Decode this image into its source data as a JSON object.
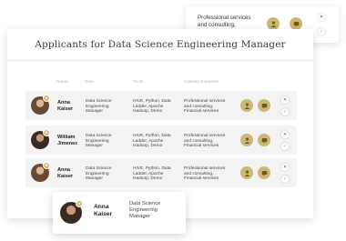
{
  "title": "Applicants for Data Science Engineering Manager",
  "columns": [
    "Name",
    "Role",
    "Tools",
    "Industry Expertise"
  ],
  "applicants": [
    {
      "first": "Anna",
      "last": "Kaiser",
      "role": [
        "Data Science",
        "Engineering",
        "Manager"
      ],
      "tools": [
        "HIVE, Python, Data",
        "Ladder, Apache",
        "Hadoop, Demo"
      ],
      "expertise": [
        "Professional services",
        "and consulting,",
        "Financial services"
      ]
    },
    {
      "first": "William",
      "last": "Jimenez",
      "role": [
        "Data Science",
        "Engineering",
        "Manager"
      ],
      "tools": [
        "HIVE, Python, Data",
        "Ladder, Apache",
        "Hadoop, Demo"
      ],
      "expertise": [
        "Professional services",
        "and consulting,",
        "Financial services"
      ]
    },
    {
      "first": "Anna",
      "last": "Kaiser",
      "role": [
        "Data Science",
        "Engineering",
        "Manager"
      ],
      "tools": [
        "HIVE, Python, Data",
        "Ladder, Apache",
        "Hadoop, Demo"
      ],
      "expertise": [
        "Professional services",
        "and consulting,",
        "Financial services"
      ]
    }
  ],
  "background_card": {
    "expertise": [
      "Professional services",
      "and consulting,"
    ]
  },
  "profile_card": {
    "first": "Anna",
    "last": "Kaiser",
    "role": [
      "Data Science",
      "Engineering",
      "Manager"
    ]
  },
  "icons": {
    "profile": "person-icon",
    "message": "chat-icon",
    "reject": "close-icon",
    "approve": "check-icon",
    "badge": "star-icon"
  },
  "colors": {
    "accent": "#ccb873",
    "row_bg": "#f3f3f3",
    "approve": "#9aa52d"
  }
}
